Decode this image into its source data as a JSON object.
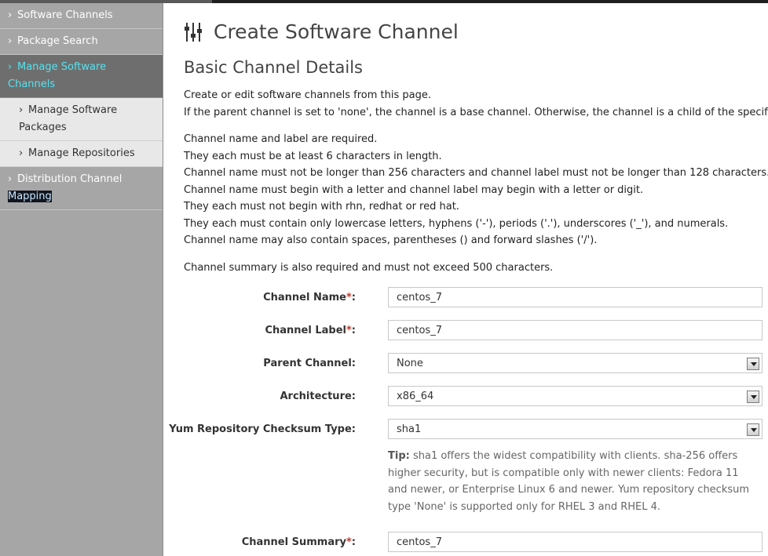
{
  "sidebar": {
    "items": [
      {
        "label": "Software Channels"
      },
      {
        "label": "Package Search"
      },
      {
        "label": "Manage Software Channels"
      },
      {
        "label": "Manage Software Packages"
      },
      {
        "label": "Manage Repositories"
      },
      {
        "label": "Distribution Channel",
        "label2": "Mapping"
      }
    ]
  },
  "page": {
    "title": "Create Software Channel",
    "section_title": "Basic Channel Details",
    "intro": [
      "Create or edit software channels from this page.",
      "If the parent channel is set to 'none', the channel is a base channel. Otherwise, the channel is a child of the specified channel."
    ],
    "rules": [
      "Channel name and label are required.",
      "They each must be at least 6 characters in length.",
      "Channel name must not be longer than 256 characters and channel label must not be longer than 128 characters.",
      "Channel name must begin with a letter and channel label may begin with a letter or digit.",
      "They each must not begin with rhn, redhat or red hat.",
      "They each must contain only lowercase letters, hyphens ('-'), periods ('.'), underscores ('_'), and numerals.",
      "Channel name may also contain spaces, parentheses () and forward slashes ('/')."
    ],
    "summary_note": "Channel summary is also required and must not exceed 500 characters."
  },
  "form": {
    "channel_name": {
      "label": "Channel Name",
      "value": "centos_7"
    },
    "channel_label": {
      "label": "Channel Label",
      "value": "centos_7"
    },
    "parent_channel": {
      "label": "Parent Channel:",
      "value": "None"
    },
    "architecture": {
      "label": "Architecture:",
      "value": "x86_64"
    },
    "checksum": {
      "label": "Yum Repository Checksum Type:",
      "value": "sha1"
    },
    "tip_label": "Tip:",
    "tip_text": "sha1 offers the widest compatibility with clients. sha-256 offers higher security, but is compatible only with newer clients: Fedora 11 and newer, or Enterprise Linux 6 and newer. Yum repository checksum type 'None' is supported only for RHEL 3 and RHEL 4.",
    "summary": {
      "label": "Channel Summary",
      "value": "centos_7"
    },
    "required_mark": "*",
    "colon": ":"
  },
  "colors": {
    "active_nav": "#56e2ef",
    "sidebar_bg": "#a6a6a6",
    "required": "#c0392b"
  }
}
